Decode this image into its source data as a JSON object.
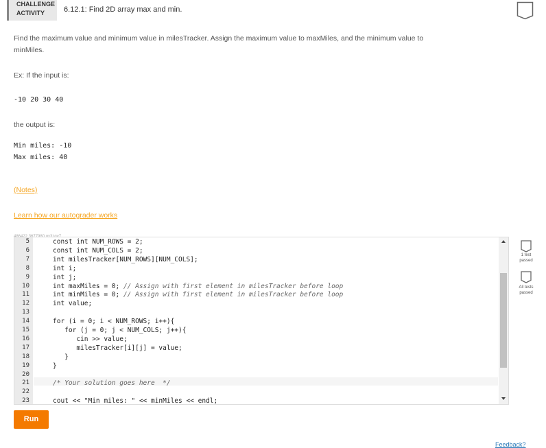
{
  "header": {
    "badge_line1": "CHALLENGE",
    "badge_line2": "ACTIVITY",
    "title": "6.12.1: Find 2D array max and min."
  },
  "prompt": {
    "line1": "Find the maximum value and minimum value in milesTracker. Assign the maximum value to maxMiles, and the minimum value to",
    "line2": "minMiles.",
    "example_label": "Ex: If the input is:",
    "example_input": "-10 20 30 40",
    "output_label": "the output is:",
    "output_line1": "Min miles: -10",
    "output_line2": "Max miles: 40",
    "notes_link": "(Notes)",
    "autograder_link": "Learn how our autograder works",
    "id_text": "486422.3677980.qx3zqy7"
  },
  "editor": {
    "lines": [
      {
        "n": "5",
        "code": "const int NUM_ROWS = 2;"
      },
      {
        "n": "6",
        "code": "const int NUM_COLS = 2;"
      },
      {
        "n": "7",
        "code": "int milesTracker[NUM_ROWS][NUM_COLS];"
      },
      {
        "n": "8",
        "code": "int i;"
      },
      {
        "n": "9",
        "code": "int j;"
      },
      {
        "n": "10",
        "code": "int maxMiles = 0; ",
        "comment": "// Assign with first element in milesTracker before loop"
      },
      {
        "n": "11",
        "code": "int minMiles = 0; ",
        "comment": "// Assign with first element in milesTracker before loop"
      },
      {
        "n": "12",
        "code": "int value;"
      },
      {
        "n": "13",
        "code": ""
      },
      {
        "n": "14",
        "code": "for (i = 0; i < NUM_ROWS; i++){"
      },
      {
        "n": "15",
        "code": "   for (j = 0; j < NUM_COLS; j++){"
      },
      {
        "n": "16",
        "code": "      cin >> value;"
      },
      {
        "n": "17",
        "code": "      milesTracker[i][j] = value;"
      },
      {
        "n": "18",
        "code": "   }"
      },
      {
        "n": "19",
        "code": "}"
      },
      {
        "n": "20",
        "code": ""
      },
      {
        "n": "21",
        "code": "",
        "comment": "/* Your solution goes here  */"
      },
      {
        "n": "22",
        "code": ""
      },
      {
        "n": "23",
        "code": "cout << \"Min miles: \" << minMiles << endl;"
      }
    ]
  },
  "run_label": "Run",
  "tests": {
    "one_test": "1 test",
    "passed": "passed",
    "all_tests": "All tests",
    "passed2": "passed"
  },
  "feedback_label": "Feedback?",
  "colors": {
    "accent": "#f47a00",
    "link": "#f5a623"
  }
}
